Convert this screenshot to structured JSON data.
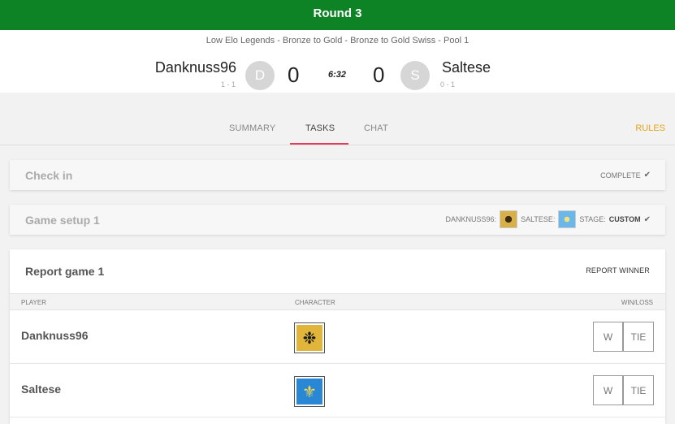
{
  "banner": {
    "title": "Round 3"
  },
  "match": {
    "event": "Low Elo Legends - Bronze to Gold - Bronze to Gold Swiss - Pool 1",
    "timer": "6:32",
    "player1": {
      "name": "Danknuss96",
      "record": "1 - 1",
      "initial": "D",
      "score": "0"
    },
    "player2": {
      "name": "Saltese",
      "record": "0 - 1",
      "initial": "S",
      "score": "0"
    }
  },
  "tabs": [
    {
      "label": "SUMMARY"
    },
    {
      "label": "TASKS"
    },
    {
      "label": "CHAT"
    }
  ],
  "active_tab": "TASKS",
  "rules_label": "RULES",
  "checkin": {
    "title": "Check in",
    "status": "COMPLETE",
    "check_glyph": "✔"
  },
  "setup": {
    "title": "Game setup 1",
    "p1_label": "DANKNUSS96:",
    "p2_label": "SALTESE:",
    "stage_label": "STAGE:",
    "stage_value": "CUSTOM",
    "check_glyph": "✔"
  },
  "report": {
    "title": "Report game 1",
    "action": "REPORT WINNER",
    "columns": {
      "player": "PLAYER",
      "character": "CHARACTER",
      "winloss": "WIN/LOSS"
    },
    "rows": [
      {
        "name": "Danknuss96",
        "character_icon": "double-eagle-icon",
        "win": "W",
        "tie": "TIE"
      },
      {
        "name": "Saltese",
        "character_icon": "fleur-de-lis-icon",
        "win": "W",
        "tie": "TIE"
      }
    ]
  },
  "colors": {
    "banner": "#0e8325",
    "accent_tab": "#e43b5a",
    "rules": "#e8a317"
  }
}
